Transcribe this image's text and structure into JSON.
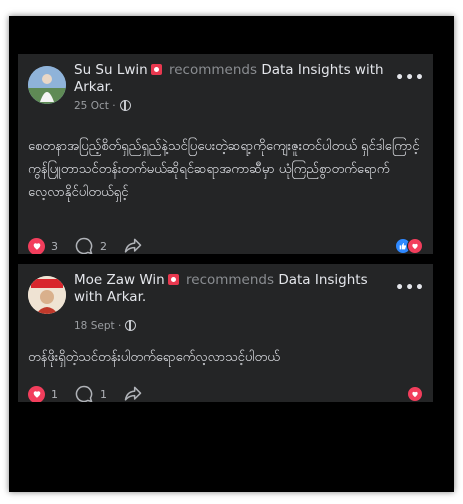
{
  "posts": [
    {
      "author": "Su Su Lwin",
      "action": "recommends",
      "page": "Data Insights with Arkar",
      "page_suffix": ".",
      "date": "25 Oct",
      "dot": "·",
      "text": "စေတနာအပြည့်စိတ်ရှည်ရှည်နဲ့သင်ပြပေးတဲ့ဆရာ့ကိုကျေးဇူးတင်ပါတယ် ရှင်ဒါကြောင့်ကွန်ပြူတာသင်တန်းတက်မယ်ဆိုရင်ဆရာအကာဆီမှာ ယုံကြည်စွာတက်ရောက်လေ့လာနိုင်ပါတယ်ရှင့်",
      "like_count": "3",
      "comment_count": "2",
      "reactions": [
        "like-icon",
        "love-icon"
      ]
    },
    {
      "author": "Moe Zaw Win",
      "action": "recommends",
      "page": "Data Insights with Arkar",
      "page_suffix": ".",
      "date": "18 Sept",
      "dot": "·",
      "text": "တန်ဖိုးရှိတဲ့သင်တန်းပါတက်ရောက်ေလ့လာသင့်ပါတယ်",
      "like_count": "1",
      "comment_count": "1",
      "reactions": [
        "love-icon"
      ]
    }
  ],
  "more_label": "•••",
  "colors": {
    "card_bg": "#242526",
    "frame_bg": "#000000",
    "love": "#f23e5c",
    "like": "#2e89ff",
    "muted": "#8a8d91"
  }
}
